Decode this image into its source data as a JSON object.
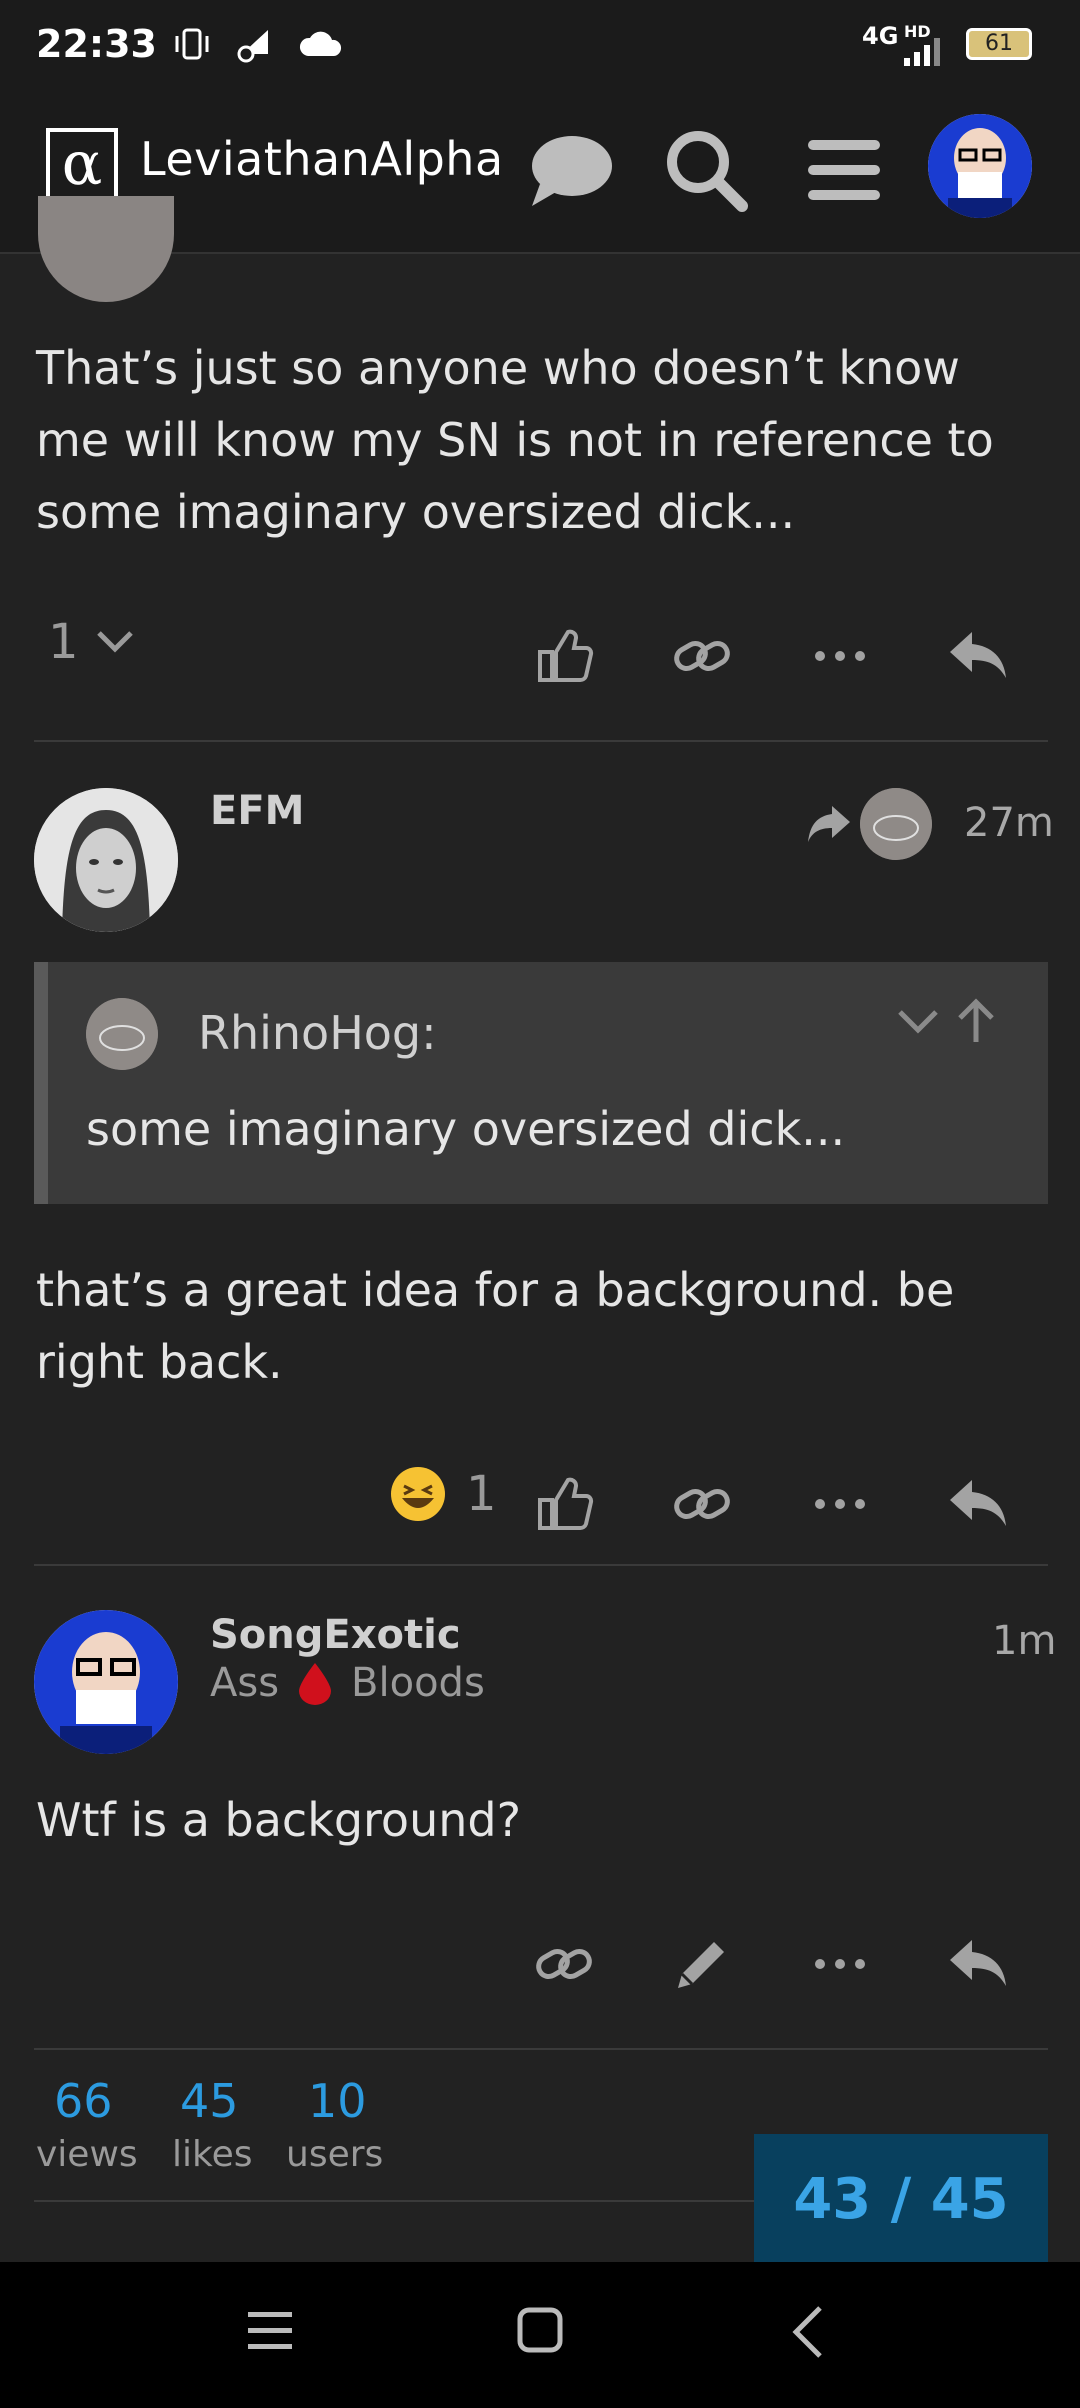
{
  "status_bar": {
    "time": "22:33",
    "network": "4G",
    "hd": "HD",
    "battery": "61"
  },
  "header": {
    "logo_glyph": "α",
    "site_title": "LeviathanAlpha"
  },
  "post1": {
    "text": "That’s just so anyone who doesn’t know me will know my SN is not in reference to some imaginary oversized dick...",
    "replies_count": "1"
  },
  "post2": {
    "username": "EFM",
    "time": "27m",
    "quote_author": "RhinoHog:",
    "quote_text": "some imaginary oversized dick...",
    "text": "that’s a great idea for a background. be right back.",
    "reaction_count": "1"
  },
  "post3": {
    "username": "SongExotic",
    "title_left": "Ass",
    "title_right": "Bloods",
    "time": "1m",
    "text": "Wtf is a background?"
  },
  "stats": {
    "views_num": "66",
    "views_label": "views",
    "likes_num": "45",
    "likes_label": "likes",
    "users_num": "10",
    "users_label": "users"
  },
  "progress": "43 / 45",
  "colors": {
    "accent": "#2c9be0",
    "progress_bg": "#08405e"
  }
}
